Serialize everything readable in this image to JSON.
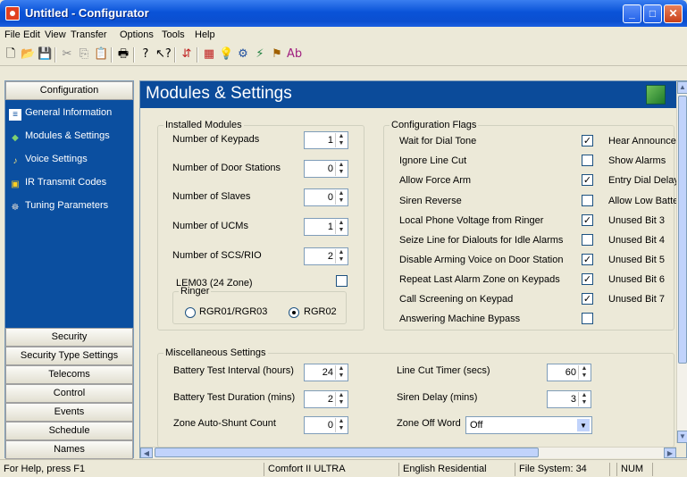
{
  "window": {
    "title": "Untitled - Configurator"
  },
  "menu": [
    "File",
    "Edit",
    "View",
    "Transfer",
    "Options",
    "Tools",
    "Help"
  ],
  "toolbar_icons": [
    "new-icon",
    "open-icon",
    "save-icon",
    "cut-icon",
    "copy-icon",
    "paste-icon",
    "print-icon",
    "help-icon",
    "context-help-icon",
    "connect-icon",
    "color-icon",
    "bulb-icon",
    "tools-icon",
    "wand-icon",
    "tag-icon",
    "abc-icon"
  ],
  "nav": {
    "header": "Configuration",
    "items": [
      "General Information",
      "Modules & Settings",
      "Voice Settings",
      "IR Transmit Codes",
      "Tuning Parameters"
    ],
    "sections": [
      "Security",
      "Security Type Settings",
      "Telecoms",
      "Control",
      "Events",
      "Schedule",
      "Names"
    ]
  },
  "page": {
    "title": "Modules & Settings"
  },
  "installed_modules": {
    "legend": "Installed Modules",
    "rows": [
      {
        "label": "Number of Keypads",
        "value": "1"
      },
      {
        "label": "Number of Door Stations",
        "value": "0"
      },
      {
        "label": "Number of Slaves",
        "value": "0"
      },
      {
        "label": "Number of UCMs",
        "value": "1"
      },
      {
        "label": "Number of SCS/RIO",
        "value": "2"
      }
    ],
    "lem_label": "LEM03 (24 Zone)",
    "lem_checked": false,
    "ringer": {
      "legend": "Ringer",
      "options": [
        "RGR01/RGR03",
        "RGR02"
      ],
      "selected": "RGR02"
    }
  },
  "config_flags": {
    "legend": "Configuration Flags",
    "left": [
      {
        "label": "Wait for Dial Tone",
        "checked": true
      },
      {
        "label": "Ignore Line Cut",
        "checked": false
      },
      {
        "label": "Allow Force Arm",
        "checked": true
      },
      {
        "label": "Siren Reverse",
        "checked": false
      },
      {
        "label": "Local Phone Voltage from Ringer",
        "checked": true
      },
      {
        "label": "Seize Line for Dialouts for Idle Alarms",
        "checked": false
      },
      {
        "label": "Disable Arming Voice on Door Station",
        "checked": true
      },
      {
        "label": "Repeat Last Alarm Zone on Keypads",
        "checked": true
      },
      {
        "label": "Call Screening on Keypad",
        "checked": true
      },
      {
        "label": "Answering Machine Bypass",
        "checked": false
      }
    ],
    "right": [
      "Hear Announce",
      "Show Alarms",
      "Entry Dial Delay",
      "Allow Low Batte",
      "Unused Bit 3",
      "Unused Bit 4",
      "Unused Bit 5",
      "Unused Bit 6",
      "Unused Bit 7"
    ]
  },
  "misc": {
    "legend": "Miscellaneous Settings",
    "left": [
      {
        "label": "Battery Test Interval (hours)",
        "value": "24"
      },
      {
        "label": "Battery Test Duration (mins)",
        "value": "2"
      },
      {
        "label": "Zone Auto-Shunt Count",
        "value": "0"
      }
    ],
    "right": [
      {
        "label": "Line Cut Timer (secs)",
        "value": "60"
      },
      {
        "label": "Siren Delay (mins)",
        "value": "3"
      }
    ],
    "zone_off_word": {
      "label": "Zone Off Word",
      "value": "Off"
    }
  },
  "status": {
    "help": "For Help, press F1",
    "model": "Comfort II ULTRA",
    "language": "English Residential",
    "filesystem": "File System: 34",
    "num": "NUM"
  }
}
